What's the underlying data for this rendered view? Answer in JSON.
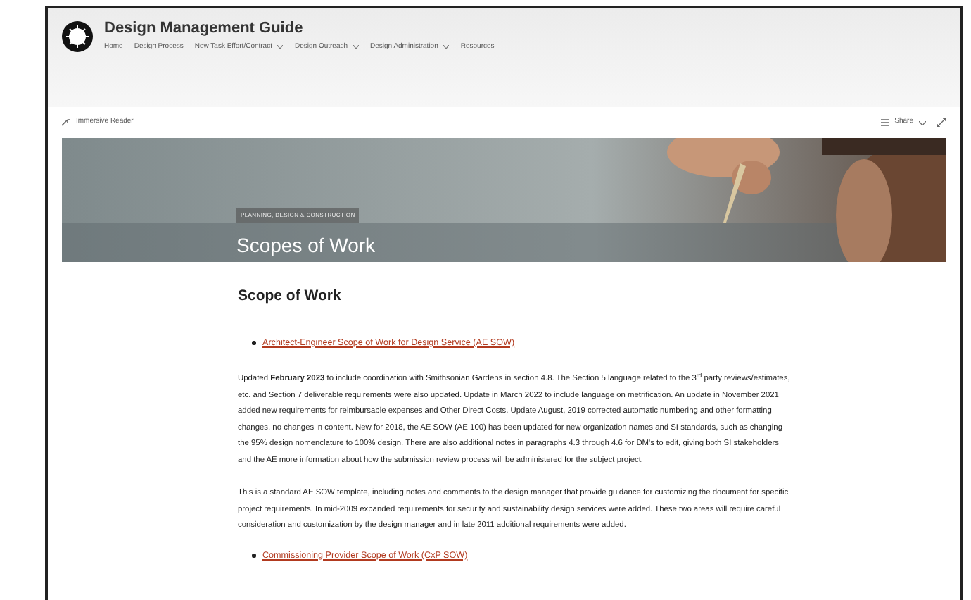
{
  "site": {
    "title": "Design Management Guide",
    "nav": [
      {
        "label": "Home",
        "dropdown": false
      },
      {
        "label": "Design Process",
        "dropdown": false
      },
      {
        "label": "New Task Effort/Contract",
        "dropdown": true
      },
      {
        "label": "Design Outreach",
        "dropdown": true
      },
      {
        "label": "Design Administration",
        "dropdown": true
      },
      {
        "label": "Resources",
        "dropdown": false
      }
    ]
  },
  "command_bar": {
    "left": "Immersive Reader",
    "right": "Share"
  },
  "hero": {
    "kind": "picture",
    "topic": "PLANNING, DESIGN & CONSTRUCTION",
    "title": "Scopes of Work"
  },
  "content": {
    "heading": "Scope of Work",
    "blocks": [
      {
        "kind": "link",
        "text": "Architect-Engineer Scope of Work for Design Service (AE SOW)"
      },
      {
        "kind": "paragraph",
        "text": "Updated **February 2023** to include coordination with Smithsonian Gardens in section 4.8.  The Section 5 language related to the 3$^{rd}$ party reviews/estimates, etc. and Section 7 deliverable requirements were also updated.  Update in March 2022 to include language on metrification. An update in November 2021 added new requirements for reimbursable expenses and Other Direct Costs. Update August, 2019 corrected automatic numbering and other formatting changes, no changes in content. New for 2018, the AE SOW (AE 100) has been updated for new organization names and SI standards, such as changing the 95% design nomenclature to 100% design. There are also additional notes in paragraphs 4.3 through 4.6 for DM's to edit, giving both SI stakeholders and the AE more information about how the submission review process will be administered for the subject project."
      },
      {
        "kind": "paragraph",
        "text": "This is a standard AE SOW template, including notes and comments to the design manager that provide guidance for customizing the document for specific project requirements. In mid-2009 expanded requirements for security and sustainability design services were added. These two areas will require careful consideration and customization by the design manager and in late 2011 additional requirements were added."
      },
      {
        "kind": "link",
        "text": "Commissioning Provider Scope of Work (CxP SOW)"
      }
    ]
  }
}
